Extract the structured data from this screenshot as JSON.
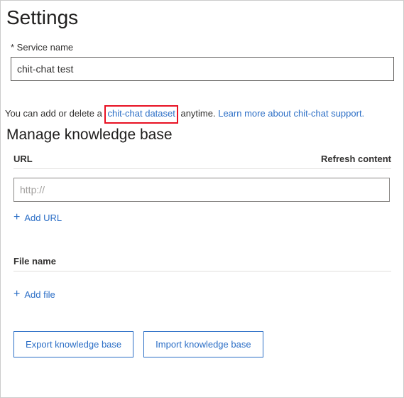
{
  "page_title": "Settings",
  "service_name_label": "Service name",
  "service_name_value": "chit-chat test",
  "helper_text": {
    "prefix": "You can add or delete a ",
    "highlight_link": "chit-chat dataset",
    "middle": " anytime. ",
    "learn_more_link": "Learn more about chit-chat support."
  },
  "manage_heading": "Manage knowledge base",
  "url_section": {
    "url_header": "URL",
    "refresh_header": "Refresh content",
    "url_placeholder": "http://",
    "add_url_label": "Add URL"
  },
  "file_section": {
    "file_header": "File name",
    "add_file_label": "Add file"
  },
  "buttons": {
    "export": "Export knowledge base",
    "import": "Import knowledge base"
  }
}
